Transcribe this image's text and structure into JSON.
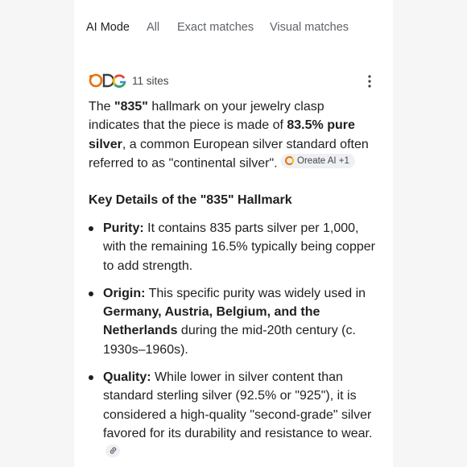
{
  "tabs": [
    {
      "label": "AI Mode",
      "active": true
    },
    {
      "label": "All",
      "active": false
    },
    {
      "label": "Exact matches",
      "active": false
    },
    {
      "label": "Visual matches",
      "active": false
    }
  ],
  "sources": {
    "count_label": "11 sites",
    "icons": [
      "source-favicon-orange-icon",
      "source-favicon-dark-icon",
      "google-g-icon"
    ]
  },
  "answer": {
    "p1_a": "The ",
    "p1_b": "\"835\"",
    "p1_c": " hallmark on your jewelry clasp indicates that the piece is made of ",
    "p1_d": "83.5% pure silver",
    "p1_e": ", a common European silver standard often referred to as \"continental silver\". ",
    "citation_label": "Oreate AI +1"
  },
  "section_heading": "Key Details of the \"835\" Hallmark",
  "bullets": [
    {
      "label": "Purity:",
      "text": " It contains 835 parts silver per 1,000, with the remaining 16.5% typically being copper to add strength."
    },
    {
      "label": "Origin:",
      "text_a": " This specific purity was widely used in ",
      "bold": "Germany, Austria, Belgium, and the Netherlands",
      "text_b": " during the mid-20th century (c. 1930s–1960s)."
    },
    {
      "label": "Quality:",
      "text": " While lower in silver content than standard sterling silver (92.5% or \"925\"), it is considered a high-quality \"second-grade\" silver favored for its durability and resistance to wear."
    }
  ],
  "colors": {
    "accent_orange": "#e8710a",
    "text": "#1f1f1f",
    "muted": "#5f6368"
  }
}
